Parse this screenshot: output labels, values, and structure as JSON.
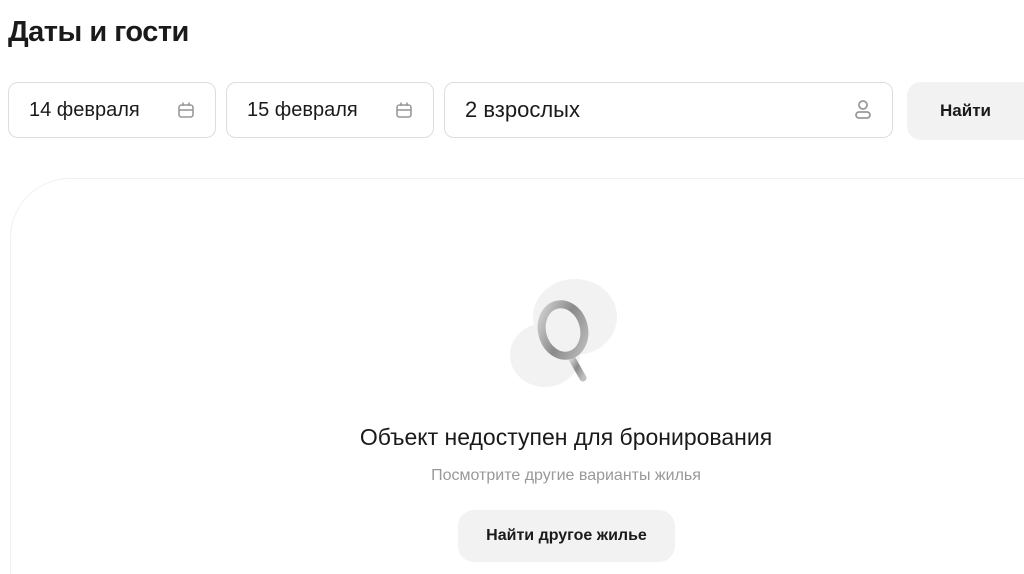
{
  "title": "Даты и гости",
  "checkin": "14 февраля",
  "checkout": "15 февраля",
  "guests": "2 взрослых",
  "find_button": "Найти",
  "unavailable": {
    "heading": "Объект недоступен для бронирования",
    "subtext": "Посмотрите другие варианты жилья",
    "button": "Найти другое жилье"
  }
}
